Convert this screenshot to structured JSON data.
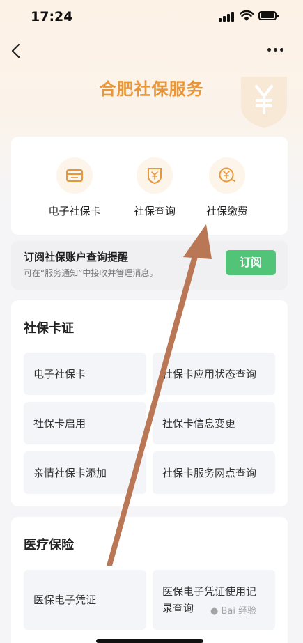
{
  "status": {
    "time": "17:24"
  },
  "header": {
    "title": "合肥社保服务"
  },
  "quick": [
    {
      "label": "电子社保卡",
      "icon": "card-icon"
    },
    {
      "label": "社保查询",
      "icon": "shield-yuan-icon"
    },
    {
      "label": "社保缴费",
      "icon": "yuan-pay-icon"
    }
  ],
  "subscribe": {
    "title": "订阅社保账户查询提醒",
    "desc": "可在“服务通知”中接收并管理消息。",
    "button": "订阅"
  },
  "sections": [
    {
      "title": "社保卡证",
      "items": [
        "电子社保卡",
        "社保卡应用状态查询",
        "社保卡启用",
        "社保卡信息变更",
        "亲情社保卡添加",
        "社保卡服务网点查询"
      ]
    },
    {
      "title": "医疗保险",
      "items": [
        "医保电子凭证",
        "医保电子凭证使用记录查询"
      ]
    }
  ],
  "colors": {
    "accent": "#e8963a",
    "button": "#52c477",
    "annotation_arrow": "#b97756"
  }
}
